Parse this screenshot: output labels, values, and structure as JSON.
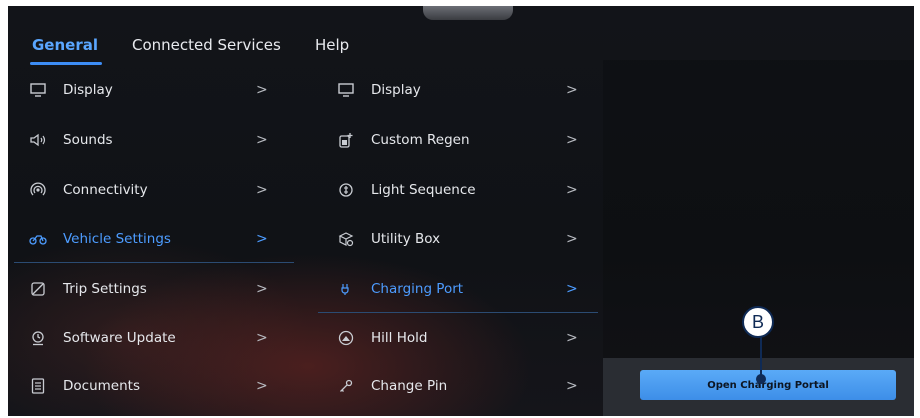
{
  "tabs": [
    {
      "label": "General"
    },
    {
      "label": "Connected Services"
    },
    {
      "label": "Help"
    }
  ],
  "left_menu": [
    {
      "label": "Display",
      "icon": "monitor-icon"
    },
    {
      "label": "Sounds",
      "icon": "speaker-icon"
    },
    {
      "label": "Connectivity",
      "icon": "wireless-icon"
    },
    {
      "label": "Vehicle Settings",
      "icon": "vehicle-icon",
      "selected": true
    },
    {
      "label": "Trip Settings",
      "icon": "trip-icon"
    },
    {
      "label": "Software Update",
      "icon": "update-icon"
    },
    {
      "label": "Documents",
      "icon": "document-icon"
    }
  ],
  "right_menu": [
    {
      "label": "Display",
      "icon": "monitor-icon"
    },
    {
      "label": "Custom Regen",
      "icon": "regen-icon"
    },
    {
      "label": "Light Sequence",
      "icon": "light-icon"
    },
    {
      "label": "Utility Box",
      "icon": "box-icon"
    },
    {
      "label": "Charging Port",
      "icon": "charging-icon",
      "selected": true
    },
    {
      "label": "Hill Hold",
      "icon": "hill-hold-icon"
    },
    {
      "label": "Change Pin",
      "icon": "key-icon"
    }
  ],
  "chevron": ">",
  "action": {
    "open_charging_portal_label": "Open Charging Portal"
  },
  "callout": {
    "label": "B"
  },
  "colors": {
    "accent": "#4d9cff",
    "button": "#4a9cf0",
    "background": "#121419"
  }
}
